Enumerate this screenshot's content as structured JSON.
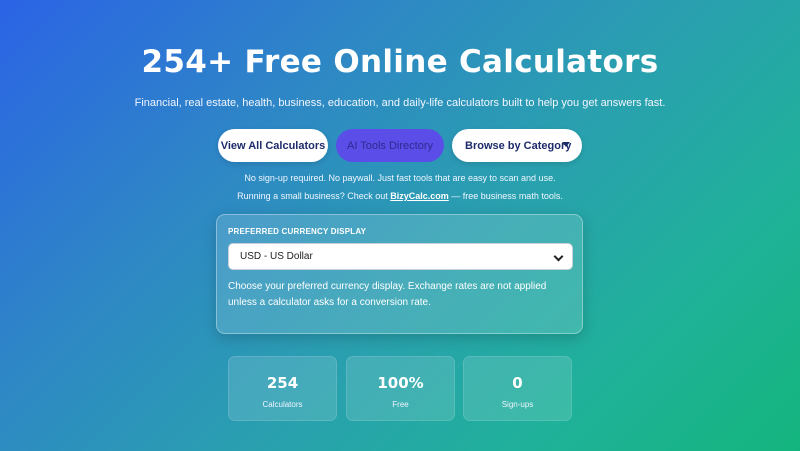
{
  "hero": {
    "title": "254+ Free Online Calculators",
    "subtitle": "Financial, real estate, health, business, education, and daily-life calculators built to help you get answers fast."
  },
  "buttons": {
    "view_all": "View All Calculators",
    "ai_tools": "AI Tools Directory",
    "browse": "Browse by Category"
  },
  "notes": {
    "line1": "No sign-up required. No paywall. Just fast tools that are easy to scan and use.",
    "line2_prefix": "Running a small business? Check out ",
    "line2_link": "BizyCalc.com",
    "line2_suffix": " — free business math tools."
  },
  "currency": {
    "label": "PREFERRED CURRENCY DISPLAY",
    "selected": "USD - US Dollar",
    "help": "Choose your preferred currency display. Exchange rates are not applied unless a calculator asks for a conversion rate."
  },
  "stats": [
    {
      "value": "254",
      "label": "Calculators"
    },
    {
      "value": "100%",
      "label": "Free"
    },
    {
      "value": "0",
      "label": "Sign-ups"
    }
  ],
  "colors": {
    "gradient_start": "#2b63e6",
    "gradient_end": "#14b57d",
    "ai_button": "#5a4de8",
    "button_text": "#1e2b6b"
  }
}
